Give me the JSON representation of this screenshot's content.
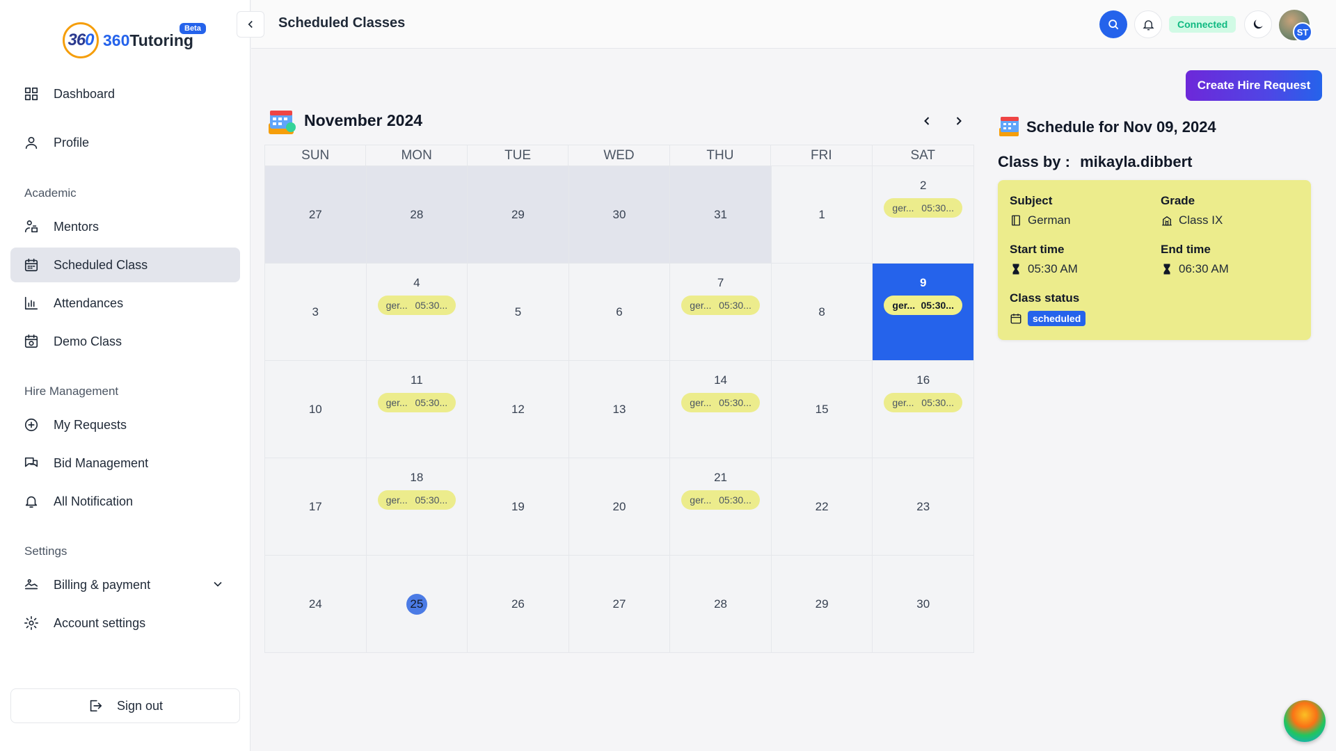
{
  "brand": {
    "logo_mark_a": "36",
    "logo_mark_b": "0",
    "name_prefix": "360",
    "name_suffix": "Tutoring",
    "badge": "Beta"
  },
  "sidebar": {
    "items_top": [
      {
        "label": "Dashboard",
        "icon": "grid-icon"
      },
      {
        "label": "Profile",
        "icon": "user-icon"
      }
    ],
    "section_academic": "Academic",
    "items_academic": [
      {
        "label": "Mentors",
        "icon": "mentors-icon"
      },
      {
        "label": "Scheduled Class",
        "icon": "calendar-icon",
        "active": true
      },
      {
        "label": "Attendances",
        "icon": "bar-chart-icon"
      },
      {
        "label": "Demo Class",
        "icon": "demo-class-icon"
      }
    ],
    "section_hire": "Hire Management",
    "items_hire": [
      {
        "label": "My Requests",
        "icon": "plus-circle-icon"
      },
      {
        "label": "Bid Management",
        "icon": "chat-icon"
      },
      {
        "label": "All Notification",
        "icon": "bell-icon"
      }
    ],
    "section_settings": "Settings",
    "items_settings": [
      {
        "label": "Billing & payment",
        "icon": "billing-icon"
      },
      {
        "label": "Account settings",
        "icon": "gear-icon"
      }
    ],
    "sign_out": "Sign out"
  },
  "header": {
    "title": "Scheduled Classes",
    "connection_status": "Connected",
    "avatar_initials": "ST"
  },
  "main": {
    "create_button": "Create Hire Request",
    "calendar": {
      "month_label": "November 2024",
      "weekdays": [
        "SUN",
        "MON",
        "TUE",
        "WED",
        "THU",
        "FRI",
        "SAT"
      ],
      "days": [
        {
          "d": "27",
          "other": true
        },
        {
          "d": "28",
          "other": true
        },
        {
          "d": "29",
          "other": true
        },
        {
          "d": "30",
          "other": true
        },
        {
          "d": "31",
          "other": true
        },
        {
          "d": "1"
        },
        {
          "d": "2",
          "event": true
        },
        {
          "d": "3"
        },
        {
          "d": "4",
          "event": true
        },
        {
          "d": "5"
        },
        {
          "d": "6"
        },
        {
          "d": "7",
          "event": true
        },
        {
          "d": "8"
        },
        {
          "d": "9",
          "event": true,
          "selected": true
        },
        {
          "d": "10"
        },
        {
          "d": "11",
          "event": true
        },
        {
          "d": "12"
        },
        {
          "d": "13"
        },
        {
          "d": "14",
          "event": true
        },
        {
          "d": "15"
        },
        {
          "d": "16",
          "event": true
        },
        {
          "d": "17"
        },
        {
          "d": "18",
          "event": true
        },
        {
          "d": "19"
        },
        {
          "d": "20"
        },
        {
          "d": "21",
          "event": true
        },
        {
          "d": "22"
        },
        {
          "d": "23"
        },
        {
          "d": "24"
        },
        {
          "d": "25",
          "today": true
        },
        {
          "d": "26"
        },
        {
          "d": "27"
        },
        {
          "d": "28"
        },
        {
          "d": "29"
        },
        {
          "d": "30"
        }
      ],
      "event_subject": "ger...",
      "event_time": "05:30..."
    },
    "schedule": {
      "title": "Schedule for Nov 09, 2024",
      "class_by_label": "Class by :",
      "class_by_value": "mikayla.dibbert",
      "subject_label": "Subject",
      "subject_value": "German",
      "grade_label": "Grade",
      "grade_value": "Class IX",
      "start_label": "Start time",
      "start_value": "05:30 AM",
      "end_label": "End time",
      "end_value": "06:30 AM",
      "status_label": "Class status",
      "status_value": "scheduled"
    }
  },
  "colors": {
    "accent": "#2563eb",
    "event": "#ecec8c",
    "connected_bg": "#d1fae5",
    "connected_text": "#10b981"
  }
}
